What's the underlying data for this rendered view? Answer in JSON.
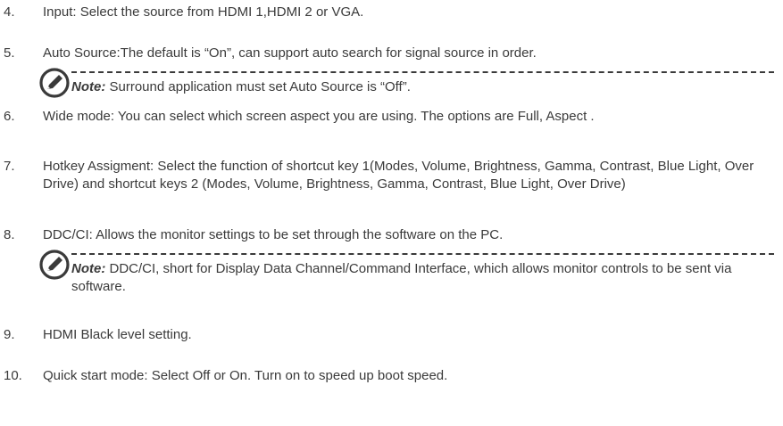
{
  "items": [
    {
      "num": "4.",
      "text": "Input: Select the source from HDMI 1,HDMI 2 or VGA."
    },
    {
      "num": "5.",
      "text": "Auto Source:The default is “On”, can support auto search for signal source in order."
    },
    {
      "num": "6.",
      "text": "Wide mode: You can select which screen aspect you are using. The options are Full, Aspect ."
    },
    {
      "num": "7.",
      "text": "Hotkey Assigment: Select the function of shortcut key 1(Modes, Volume, Brightness, Gamma, Contrast, Blue Light, Over Drive) and shortcut keys 2 (Modes, Volume, Brightness, Gamma, Contrast, Blue Light, Over Drive)"
    },
    {
      "num": "8.",
      "text": "DDC/CI: Allows the monitor settings to be set through the software on the PC."
    },
    {
      "num": "9.",
      "text": "HDMI Black level setting."
    },
    {
      "num": "10.",
      "text": "Quick start mode: Select Off or On. Turn on to speed up boot speed."
    }
  ],
  "notes": [
    {
      "label": "Note:",
      "text": " Surround application must set Auto Source is “Off”."
    },
    {
      "label": "Note:",
      "text": " DDC/CI, short for Display Data Channel/Command Interface, which allows monitor controls to be sent via software."
    }
  ]
}
